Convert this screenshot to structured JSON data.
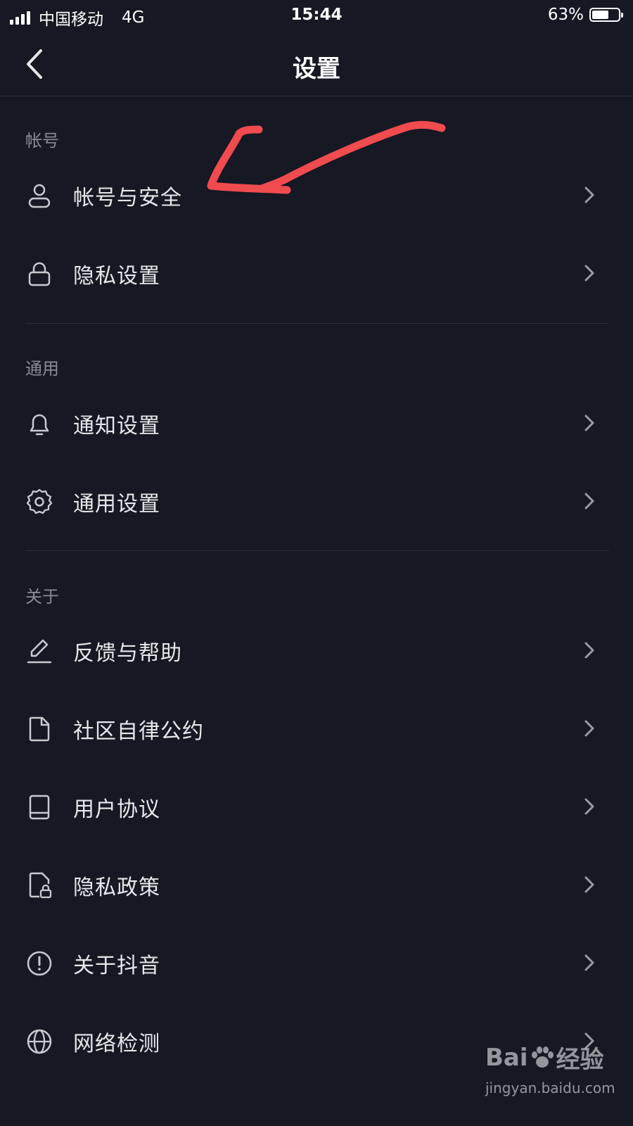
{
  "status_bar": {
    "carrier": "中国移动",
    "network": "4G",
    "time": "15:44",
    "battery_percent": "63%",
    "battery_level": 0.63
  },
  "nav": {
    "title": "设置",
    "back_icon": "chevron-left-icon"
  },
  "sections": [
    {
      "title": "帐号",
      "items": [
        {
          "label": "帐号与安全",
          "icon": "user-icon"
        },
        {
          "label": "隐私设置",
          "icon": "lock-icon"
        }
      ]
    },
    {
      "title": "通用",
      "items": [
        {
          "label": "通知设置",
          "icon": "bell-icon"
        },
        {
          "label": "通用设置",
          "icon": "gear-icon"
        }
      ]
    },
    {
      "title": "关于",
      "items": [
        {
          "label": "反馈与帮助",
          "icon": "edit-icon"
        },
        {
          "label": "社区自律公约",
          "icon": "document-icon"
        },
        {
          "label": "用户协议",
          "icon": "book-icon"
        },
        {
          "label": "隐私政策",
          "icon": "privacy-document-icon"
        },
        {
          "label": "关于抖音",
          "icon": "info-circle-icon"
        },
        {
          "label": "网络检测",
          "icon": "globe-icon"
        }
      ]
    }
  ],
  "annotation": {
    "type": "hand-drawn-arrow",
    "color": "#f04b4f"
  },
  "watermark": {
    "logo_prefix": "Bai",
    "logo_suffix": "经验",
    "url": "jingyan.baidu.com"
  },
  "colors": {
    "background": "#161823",
    "text": "#e8e8ea",
    "secondary_text": "#8a8b93",
    "divider": "#2b2d38"
  }
}
